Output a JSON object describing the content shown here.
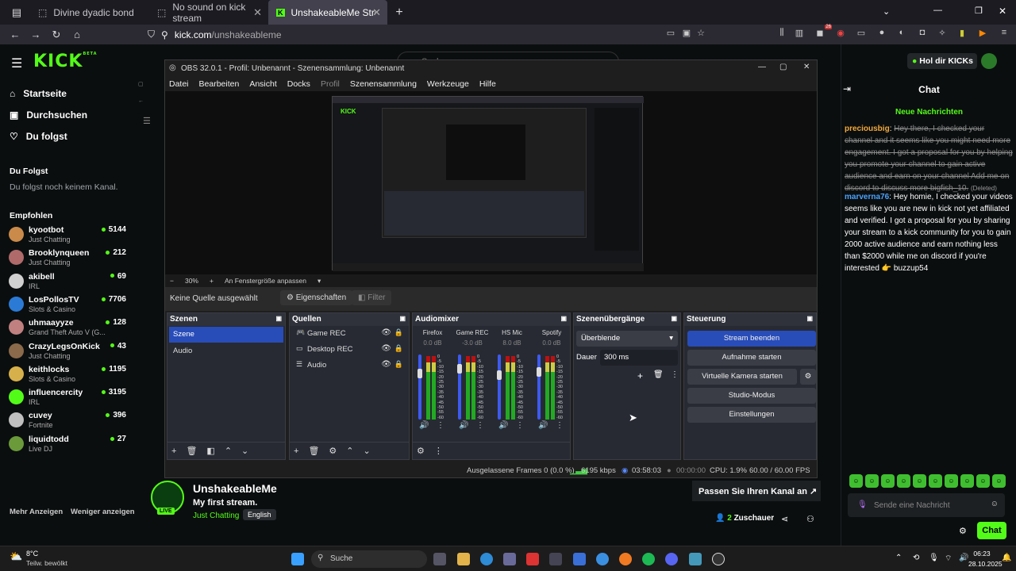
{
  "browser": {
    "tabs": [
      {
        "title": "Divine dyadic bond"
      },
      {
        "title": "No sound on kick stream"
      },
      {
        "title": "UnshakeableMe Stream - Watch"
      }
    ],
    "url_host": "kick.com",
    "url_path": "/unshakeableme",
    "new_tab": "+",
    "ext_badge": "26"
  },
  "kick": {
    "logo": "KICK",
    "beta": "BETA",
    "nav": [
      "Startseite",
      "Durchsuchen",
      "Du folgst"
    ],
    "following_head": "Du Folgst",
    "following_empty": "Du folgst noch keinem Kanal.",
    "recommended_head": "Empfohlen",
    "channels": [
      {
        "name": "kyootbot",
        "category": "Just Chatting",
        "viewers": "5144",
        "color": "#c98a4a"
      },
      {
        "name": "Brooklynqueen",
        "category": "Just Chatting",
        "viewers": "212",
        "color": "#b06a6a"
      },
      {
        "name": "akibell",
        "category": "IRL",
        "viewers": "69",
        "color": "#d0d0d0"
      },
      {
        "name": "LosPollosTV",
        "category": "Slots & Casino",
        "viewers": "7706",
        "color": "#2b7bd6"
      },
      {
        "name": "uhmaayyze",
        "category": "Grand Theft Auto V (G...",
        "viewers": "128",
        "color": "#c08080"
      },
      {
        "name": "CrazyLegsOnKick",
        "category": "Just Chatting",
        "viewers": "43",
        "color": "#8a6a4a"
      },
      {
        "name": "keithlocks",
        "category": "Slots & Casino",
        "viewers": "1195",
        "color": "#d6b04a"
      },
      {
        "name": "influencercity",
        "category": "IRL",
        "viewers": "3195",
        "color": "#53fc18"
      },
      {
        "name": "cuvey",
        "category": "Fortnite",
        "viewers": "396",
        "color": "#c0c0c0"
      },
      {
        "name": "liquidtodd",
        "category": "Live DJ",
        "viewers": "27",
        "color": "#6a9a3a"
      }
    ],
    "show_more": "Mehr Anzeigen",
    "show_less": "Weniger anzeigen",
    "search_placeholder": "Suchen",
    "streamer": {
      "name": "UnshakeableMe",
      "title": "My first stream.",
      "category": "Just Chatting",
      "language": "English",
      "live": "LIVE",
      "customize": "Passen Sie Ihren Kanal an",
      "viewers": "2",
      "watch": "Zuschauer"
    },
    "kicks_button": "Hol dir KICKs",
    "chat": {
      "title": "Chat",
      "new_messages": "Neue Nachrichten",
      "messages": [
        {
          "user": "preciousbig",
          "text": "Hey there, I checked your channel and it seems like you might need more engagement. I got a proposal for you by helping you promote your channel to gain active audience and earn on your channel Add me on discord to discuss more bigfish_10.",
          "deleted": "(Deleted)"
        },
        {
          "user": "marverna76",
          "text": "Hey homie, I checked your videos seems like you are new in kick not yet affiliated and verified. I got a proposal for you by sharing your stream to a kick community for you to gain 2000 active audience and earn nothing less than $2000 while me on discord if you're interested 👉 buzzup54"
        }
      ],
      "input_placeholder": "Sende eine Nachricht",
      "send": "Chat"
    }
  },
  "obs": {
    "title": "OBS 32.0.1 - Profil: Unbenannt - Szenensammlung: Unbenannt",
    "menu": [
      "Datei",
      "Bearbeiten",
      "Ansicht",
      "Docks",
      "Profil",
      "Szenensammlung",
      "Werkzeuge",
      "Hilfe"
    ],
    "zoom": "30%",
    "fit": "An Fenstergröße anpassen",
    "no_source": "Keine Quelle ausgewählt",
    "properties": "Eigenschaften",
    "filters": "Filter",
    "scenes_head": "Szenen",
    "scenes": [
      "Szene",
      "Audio"
    ],
    "sources_head": "Quellen",
    "sources": [
      "Game REC",
      "Desktop REC",
      "Audio"
    ],
    "mixer_head": "Audiomixer",
    "mixer": [
      {
        "name": "Firefox",
        "db": "0.0 dB"
      },
      {
        "name": "Game REC",
        "db": "-3.0 dB"
      },
      {
        "name": "HS Mic",
        "db": "8.0 dB"
      },
      {
        "name": "Spotify",
        "db": "0.0 dB"
      }
    ],
    "meter_scale": [
      "0",
      "-5",
      "-10",
      "-15",
      "-20",
      "-25",
      "-30",
      "-35",
      "-40",
      "-45",
      "-50",
      "-55",
      "-60"
    ],
    "trans_head": "Szenenübergänge",
    "transition": "Überblende",
    "duration_label": "Dauer",
    "duration": "300 ms",
    "ctrl_head": "Steuerung",
    "controls": [
      "Stream beenden",
      "Aufnahme starten",
      "Virtuelle Kamera starten",
      "Studio-Modus",
      "Einstellungen"
    ],
    "status": {
      "dropped": "Ausgelassene Frames 0 (0.0 %)",
      "kbps": "6195 kbps",
      "live_time": "03:58:03",
      "rec_time": "00:00:00",
      "cpu": "CPU: 1.9%",
      "fps": "60.00 / 60.00 FPS"
    }
  },
  "taskbar": {
    "weather_temp": "8°C",
    "weather_desc": "Teilw. bewölkt",
    "search": "Suche",
    "time": "06:23",
    "date": "28.10.2025"
  }
}
